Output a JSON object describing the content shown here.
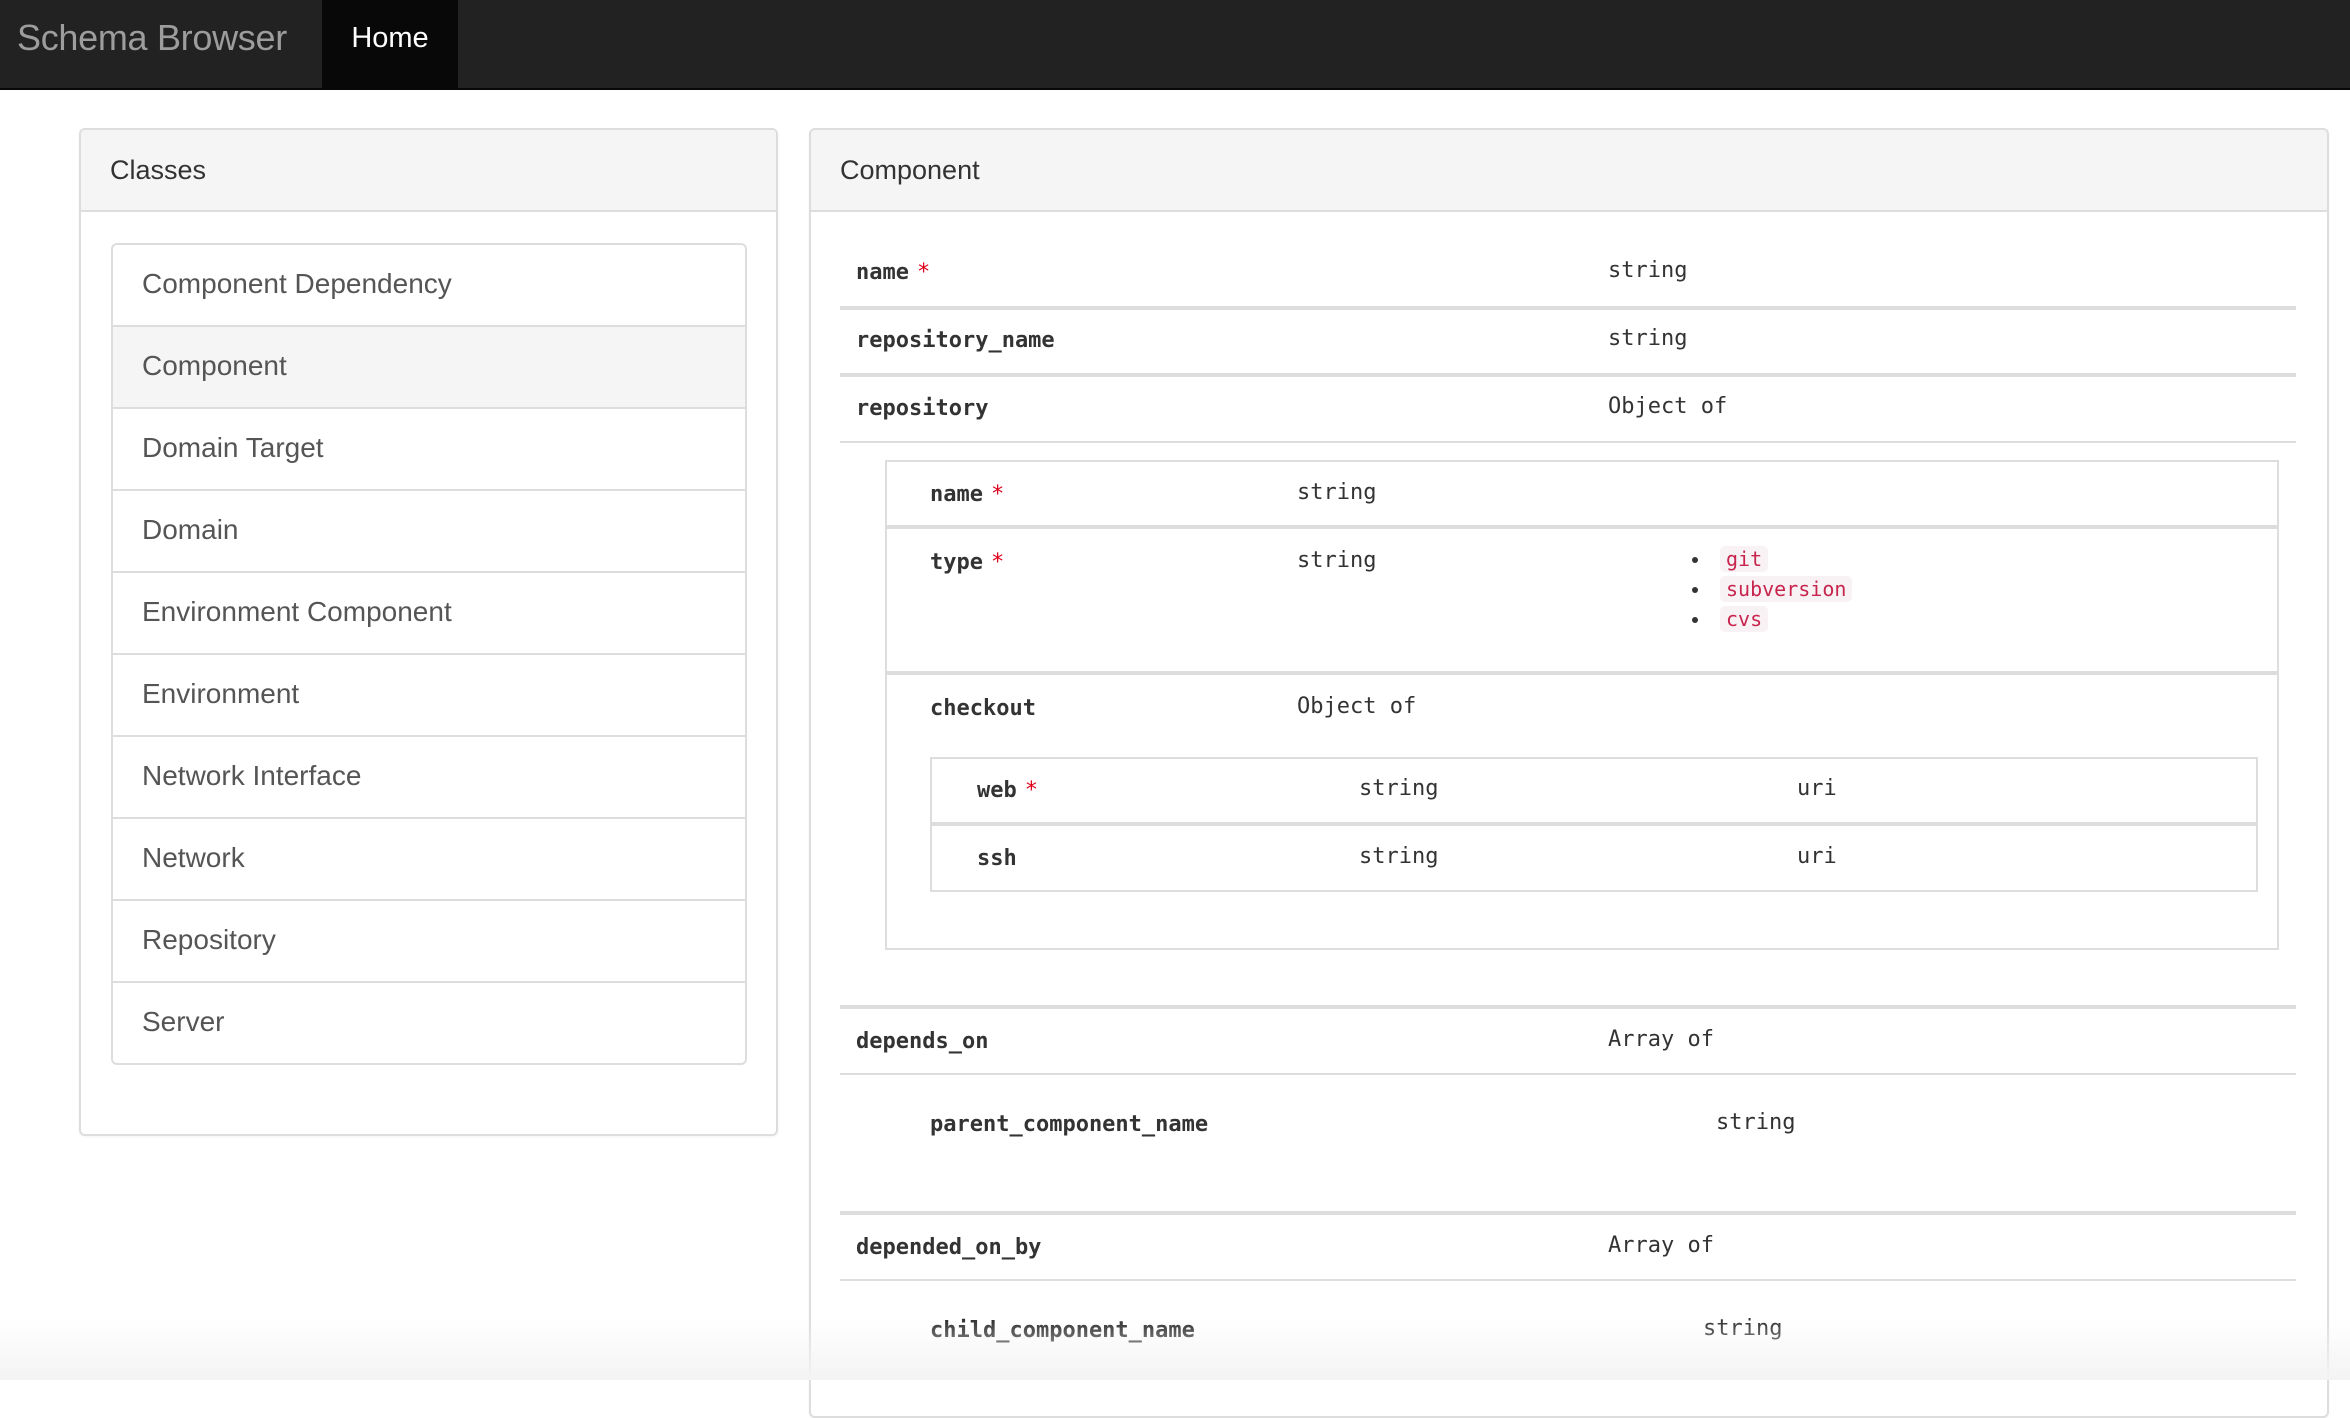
{
  "navbar": {
    "brand": "Schema Browser",
    "items": [
      {
        "label": "Home",
        "active": true
      }
    ]
  },
  "classes_panel": {
    "title": "Classes",
    "items": [
      {
        "label": "Component Dependency",
        "active": false
      },
      {
        "label": "Component",
        "active": true
      },
      {
        "label": "Domain Target",
        "active": false
      },
      {
        "label": "Domain",
        "active": false
      },
      {
        "label": "Environment Component",
        "active": false
      },
      {
        "label": "Environment",
        "active": false
      },
      {
        "label": "Network Interface",
        "active": false
      },
      {
        "label": "Network",
        "active": false
      },
      {
        "label": "Repository",
        "active": false
      },
      {
        "label": "Server",
        "active": false
      }
    ]
  },
  "component_panel": {
    "title": "Component",
    "required_marker": "*",
    "fields": {
      "name": {
        "name": "name",
        "type": "string",
        "required": true
      },
      "repository_name": {
        "name": "repository_name",
        "type": "string",
        "required": false
      },
      "repository": {
        "name": "repository",
        "type": "Object of",
        "required": false,
        "properties": {
          "name": {
            "name": "name",
            "type": "string",
            "required": true
          },
          "type": {
            "name": "type",
            "type": "string",
            "required": true,
            "enum": [
              "git",
              "subversion",
              "cvs"
            ]
          },
          "checkout": {
            "name": "checkout",
            "type": "Object of",
            "required": false,
            "properties": {
              "web": {
                "name": "web",
                "type": "string",
                "format": "uri",
                "required": true
              },
              "ssh": {
                "name": "ssh",
                "type": "string",
                "format": "uri",
                "required": false
              }
            }
          }
        }
      },
      "depends_on": {
        "name": "depends_on",
        "type": "Array of",
        "items": {
          "name": "parent_component_name",
          "type": "string"
        }
      },
      "depended_on_by": {
        "name": "depended_on_by",
        "type": "Array of",
        "items": {
          "name": "child_component_name",
          "type": "string"
        }
      }
    }
  },
  "colors": {
    "navbar_bg": "#222222",
    "navbar_active_bg": "#080808",
    "brand_text": "#9d9d9d",
    "required_marker": "#e0001b",
    "code_text": "#c7254e",
    "code_bg": "#f9f2f4",
    "active_item_bg": "#f5f5f5"
  }
}
